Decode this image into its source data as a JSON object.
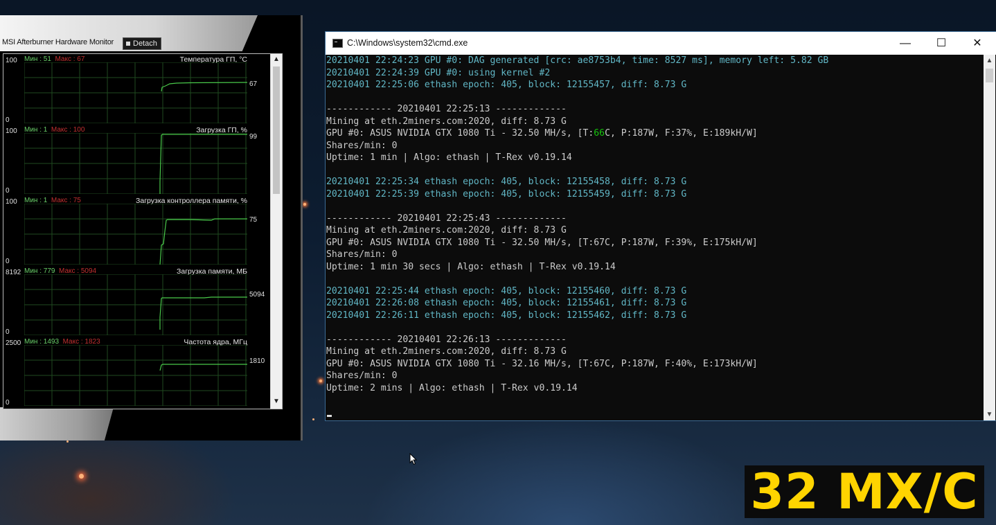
{
  "afterburner": {
    "title": "MSI Afterburner Hardware Monitor",
    "detach_label": "Detach",
    "graphs": [
      {
        "ymax": "100",
        "ymin": "0",
        "min_label": "Мин : 51",
        "max_label": "Макс : 67",
        "title": "Температура ГП, °С",
        "value": "67"
      },
      {
        "ymax": "100",
        "ymin": "0",
        "min_label": "Мин : 1",
        "max_label": "Макс : 100",
        "title": "Загрузка ГП, %",
        "value": "99"
      },
      {
        "ymax": "100",
        "ymin": "0",
        "min_label": "Мин : 1",
        "max_label": "Макс : 75",
        "title": "Загрузка контроллера памяти, %",
        "value": "75"
      },
      {
        "ymax": "8192",
        "ymin": "0",
        "min_label": "Мин : 779",
        "max_label": "Макс : 5094",
        "title": "Загрузка памяти, МБ",
        "value": "5094"
      },
      {
        "ymax": "2500",
        "ymin": "0",
        "min_label": "Мин : 1493",
        "max_label": "Макс : 1823",
        "title": "Частота ядра, МГц",
        "value": "1810"
      }
    ]
  },
  "cmd": {
    "title": "C:\\Windows\\system32\\cmd.exe",
    "minimize": "—",
    "maximize": "☐",
    "close": "✕",
    "lines": [
      {
        "style": "teal",
        "text": "20210401 22:24:23 GPU #0: DAG generated [crc: ae8753b4, time: 8527 ms], memory left: 5.82 GB"
      },
      {
        "style": "teal",
        "text": "20210401 22:24:39 GPU #0: using kernel #2"
      },
      {
        "style": "teal",
        "text": "20210401 22:25:06 ethash epoch: 405, block: 12155457, diff: 8.73 G"
      },
      {
        "style": "plain",
        "text": ""
      },
      {
        "style": "plain",
        "text": "------------ 20210401 22:25:13 -------------"
      },
      {
        "style": "plain",
        "text": "Mining at eth.2miners.com:2020, diff: 8.73 G"
      },
      {
        "style": "gpu",
        "pre": "GPU #0: ASUS NVIDIA GTX 1080 Ti - 32.50 MH/s, [T:",
        "temp": "66",
        "post": "C, P:187W, F:37%, E:189kH/W]"
      },
      {
        "style": "plain",
        "text": "Shares/min: 0"
      },
      {
        "style": "plain",
        "text": "Uptime: 1 min | Algo: ethash | T-Rex v0.19.14"
      },
      {
        "style": "plain",
        "text": ""
      },
      {
        "style": "teal",
        "text": "20210401 22:25:34 ethash epoch: 405, block: 12155458, diff: 8.73 G"
      },
      {
        "style": "teal",
        "text": "20210401 22:25:39 ethash epoch: 405, block: 12155459, diff: 8.73 G"
      },
      {
        "style": "plain",
        "text": ""
      },
      {
        "style": "plain",
        "text": "------------ 20210401 22:25:43 -------------"
      },
      {
        "style": "plain",
        "text": "Mining at eth.2miners.com:2020, diff: 8.73 G"
      },
      {
        "style": "plain",
        "text": "GPU #0: ASUS NVIDIA GTX 1080 Ti - 32.50 MH/s, [T:67C, P:187W, F:39%, E:175kH/W]"
      },
      {
        "style": "plain",
        "text": "Shares/min: 0"
      },
      {
        "style": "plain",
        "text": "Uptime: 1 min 30 secs | Algo: ethash | T-Rex v0.19.14"
      },
      {
        "style": "plain",
        "text": ""
      },
      {
        "style": "teal",
        "text": "20210401 22:25:44 ethash epoch: 405, block: 12155460, diff: 8.73 G"
      },
      {
        "style": "teal",
        "text": "20210401 22:26:08 ethash epoch: 405, block: 12155461, diff: 8.73 G"
      },
      {
        "style": "teal",
        "text": "20210401 22:26:11 ethash epoch: 405, block: 12155462, diff: 8.73 G"
      },
      {
        "style": "plain",
        "text": ""
      },
      {
        "style": "plain",
        "text": "------------ 20210401 22:26:13 -------------"
      },
      {
        "style": "plain",
        "text": "Mining at eth.2miners.com:2020, diff: 8.73 G"
      },
      {
        "style": "plain",
        "text": "GPU #0: ASUS NVIDIA GTX 1080 Ti - 32.16 MH/s, [T:67C, P:187W, F:40%, E:173kH/W]"
      },
      {
        "style": "plain",
        "text": "Shares/min: 0"
      },
      {
        "style": "plain",
        "text": "Uptime: 2 mins | Algo: ethash | T-Rex v0.19.14"
      }
    ]
  },
  "overlay": {
    "text": "32 МХ/С"
  },
  "colors": {
    "cmd_text": "#cccccc",
    "cmd_teal": "#61b7c6",
    "temp_green": "#16c60c",
    "overlay_yellow": "#ffd400",
    "graph_line": "#49c94a"
  }
}
